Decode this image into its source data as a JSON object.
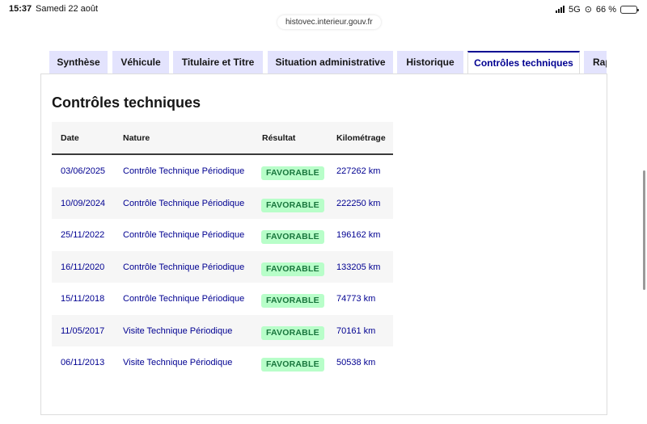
{
  "status_bar": {
    "time": "15:37",
    "date": "Samedi 22 août",
    "network": "5G",
    "battery": "66 %",
    "battery_level": 0.66
  },
  "browser": {
    "url": "histovec.interieur.gouv.fr"
  },
  "tabs": [
    {
      "label": "Synthèse",
      "active": false
    },
    {
      "label": "Véhicule",
      "active": false
    },
    {
      "label": "Titulaire et Titre",
      "active": false
    },
    {
      "label": "Situation administrative",
      "active": false
    },
    {
      "label": "Historique",
      "active": false
    },
    {
      "label": "Contrôles techniques",
      "active": true
    },
    {
      "label": "Rap",
      "active": false
    }
  ],
  "section": {
    "title": "Contrôles techniques",
    "columns": [
      "Date",
      "Nature",
      "Résultat",
      "Kilométrage"
    ],
    "rows": [
      {
        "date": "03/06/2025",
        "nature": "Contrôle Technique Périodique",
        "result": "FAVORABLE",
        "km": "227262 km"
      },
      {
        "date": "10/09/2024",
        "nature": "Contrôle Technique Périodique",
        "result": "FAVORABLE",
        "km": "222250 km"
      },
      {
        "date": "25/11/2022",
        "nature": "Contrôle Technique Périodique",
        "result": "FAVORABLE",
        "km": "196162 km"
      },
      {
        "date": "16/11/2020",
        "nature": "Contrôle Technique Périodique",
        "result": "FAVORABLE",
        "km": "133205 km"
      },
      {
        "date": "15/11/2018",
        "nature": "Contrôle Technique Périodique",
        "result": "FAVORABLE",
        "km": "74773 km"
      },
      {
        "date": "11/05/2017",
        "nature": "Visite Technique Périodique",
        "result": "FAVORABLE",
        "km": "70161 km"
      },
      {
        "date": "06/11/2013",
        "nature": "Visite Technique Périodique",
        "result": "FAVORABLE",
        "km": "50538 km"
      }
    ]
  },
  "colors": {
    "accent": "#000091",
    "tab_bg": "#e3e3fd",
    "badge_bg": "#b8fec9",
    "badge_text": "#18753c"
  }
}
